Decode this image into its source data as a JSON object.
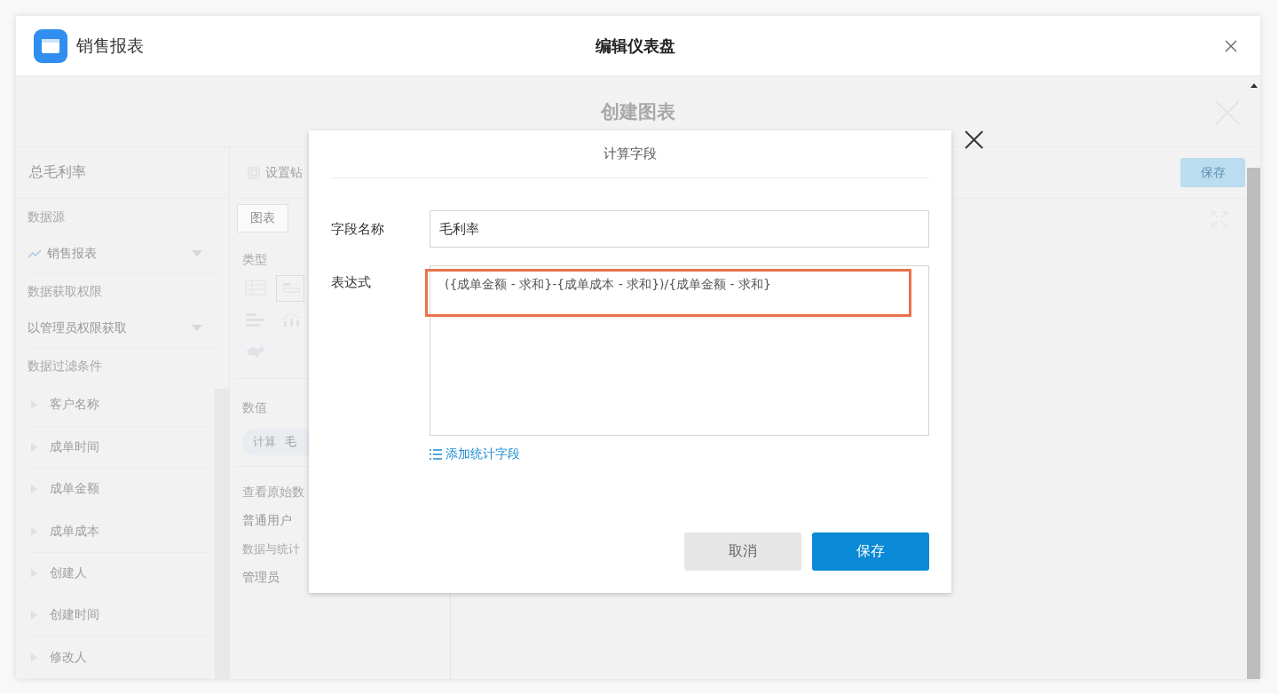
{
  "app": {
    "name": "销售报表"
  },
  "window": {
    "title": "编辑仪表盘"
  },
  "editor": {
    "title": "创建图表",
    "chart_name": "总毛利率",
    "drill_button": "设置钻",
    "save_button": "保存",
    "sidebar": {
      "source_label": "数据源",
      "source": "销售报表",
      "permission_label": "数据获取权限",
      "permission": "以管理员权限获取",
      "filter_label": "数据过滤条件",
      "fields": [
        "客户名称",
        "成单时间",
        "成单金额",
        "成单成本",
        "创建人",
        "创建时间",
        "修改人"
      ]
    },
    "config": {
      "tabs": [
        {
          "label": "图表",
          "selected": true
        }
      ],
      "type_label": "类型",
      "chart_types": [
        {
          "kind": "table",
          "selected": false
        },
        {
          "kind": "card",
          "selected": true
        },
        {
          "kind": "bar",
          "selected": false
        },
        {
          "kind": "combo",
          "selected": false
        },
        {
          "kind": "map",
          "selected": false
        }
      ],
      "value_label": "数值",
      "value_chip": {
        "tag": "计算",
        "name": "毛"
      },
      "raw_label": "查看原始数",
      "normal_user": "普通用户",
      "normal_desc": "数据与统计",
      "admin": "管理员"
    }
  },
  "dialog": {
    "title": "计算字段",
    "name_label": "字段名称",
    "name_value": "毛利率",
    "expr_label": "表达式",
    "expr_value": "({成单金额 - 求和}-{成单成本 - 求和})/{成单金额 - 求和}",
    "highlight": true,
    "add_link": "添加统计字段",
    "buttons": [
      {
        "label": "取消",
        "kind": "secondary"
      },
      {
        "label": "保存",
        "kind": "primary"
      }
    ]
  }
}
